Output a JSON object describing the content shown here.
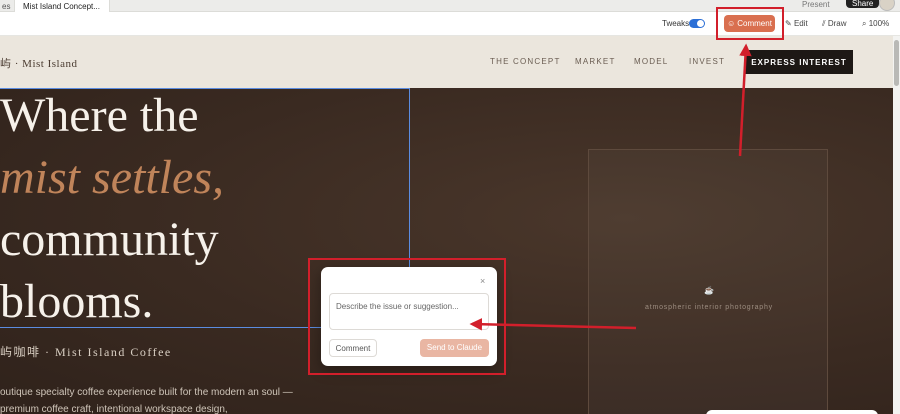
{
  "browser": {
    "tabs": [
      {
        "label": "es"
      },
      {
        "label": "Mist Island Concept..."
      }
    ],
    "present_label": "Present",
    "share_label": "Share"
  },
  "toolbar": {
    "tweaks_label": "Tweaks",
    "tweaks_enabled": true,
    "comment_label": "Comment",
    "edit_label": "Edit",
    "draw_label": "Draw",
    "zoom_label": "100%"
  },
  "site": {
    "brand": "屿 · Mist Island",
    "nav": [
      "THE CONCEPT",
      "MARKET",
      "MODEL",
      "INVEST"
    ],
    "cta": "EXPRESS INTEREST",
    "headline": [
      "Where the",
      "mist settles,",
      "community",
      "blooms."
    ],
    "subtitle": "屿咖啡 · Mist Island Coffee",
    "description": "outique specialty coffee experience built for the modern an soul — premium coffee craft, intentional workspace design,",
    "photo_caption": "atmospheric interior photography",
    "photo_icon": "☕"
  },
  "comment_popover": {
    "close_symbol": "×",
    "placeholder": "Describe the issue or suggestion...",
    "comment_button": "Comment",
    "send_button": "Send to Claude"
  },
  "colors": {
    "accent": "#d96f4f",
    "annotation_red": "#d21f2b",
    "selection_blue": "#5b8ce0",
    "hero_bg": "#3a2a21",
    "headline_accent": "#c0845a"
  }
}
